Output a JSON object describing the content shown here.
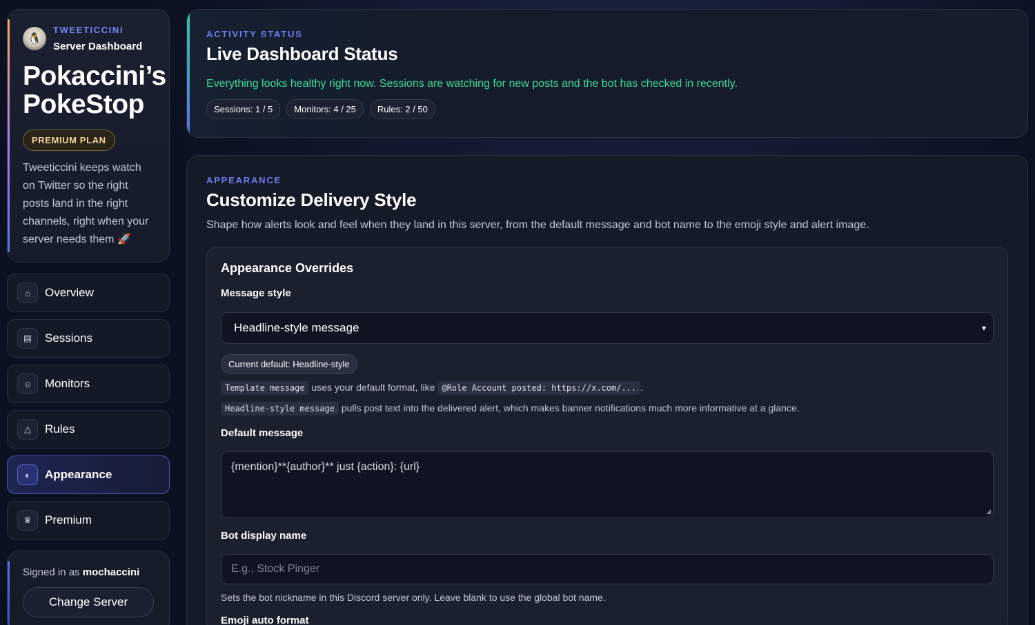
{
  "brand": {
    "kicker": "TWEETICCINI",
    "subtitle": "Server Dashboard",
    "server_name": "Pokaccini’s PokeStop",
    "plan": "PREMIUM PLAN",
    "description": "Tweeticcini keeps watch on Twitter so the right posts land in the right channels, right when your server needs them 🚀",
    "avatar_icon": "penguin-avatar"
  },
  "nav": {
    "items": [
      {
        "label": "Overview",
        "icon": "home-icon",
        "glyph": "⌂"
      },
      {
        "label": "Sessions",
        "icon": "session-icon",
        "glyph": "▤"
      },
      {
        "label": "Monitors",
        "icon": "user-icon",
        "glyph": "☺"
      },
      {
        "label": "Rules",
        "icon": "warning-icon",
        "glyph": "△"
      },
      {
        "label": "Appearance",
        "icon": "palette-icon",
        "glyph": "◐",
        "active": true
      },
      {
        "label": "Premium",
        "icon": "crown-icon",
        "glyph": "♛"
      }
    ]
  },
  "account": {
    "signed_prefix": "Signed in as",
    "username": "mochaccini",
    "change_server_label": "Change Server"
  },
  "status": {
    "kicker": "ACTIVITY STATUS",
    "title": "Live Dashboard Status",
    "message": "Everything looks healthy right now. Sessions are watching for new posts and the bot has checked in recently.",
    "pills": [
      "Sessions: 1 / 5",
      "Monitors: 4 / 25",
      "Rules: 2 / 50"
    ]
  },
  "appearance": {
    "kicker": "APPEARANCE",
    "title": "Customize Delivery Style",
    "description": "Shape how alerts look and feel when they land in this server, from the default message and bot name to the emoji style and alert image.",
    "overrides": {
      "title": "Appearance Overrides",
      "message_style_label": "Message style",
      "message_style_value": "Headline-style message",
      "current_default": "Current default: Headline-style",
      "help1_code": "Template message",
      "help1_text": "uses your default format, like",
      "help1_example": "@Role Account posted: https://x.com/...",
      "help1_end": ".",
      "help2_code": "Headline-style message",
      "help2_text": "pulls post text into the delivered alert, which makes banner notifications much more informative at a glance.",
      "default_message_label": "Default message",
      "default_message_value": "{mention}**{author}** just {action}: {url}",
      "bot_name_label": "Bot display name",
      "bot_name_placeholder": "E.g., Stock Pinger",
      "bot_name_help": "Sets the bot nickname in this Discord server only. Leave blank to use the global bot name.",
      "emoji_label": "Emoji auto format"
    }
  },
  "colors": {
    "accent": "#6f7cf0",
    "success": "#3ddc97",
    "premium": "#f0d39a",
    "background": "#0b1120"
  }
}
